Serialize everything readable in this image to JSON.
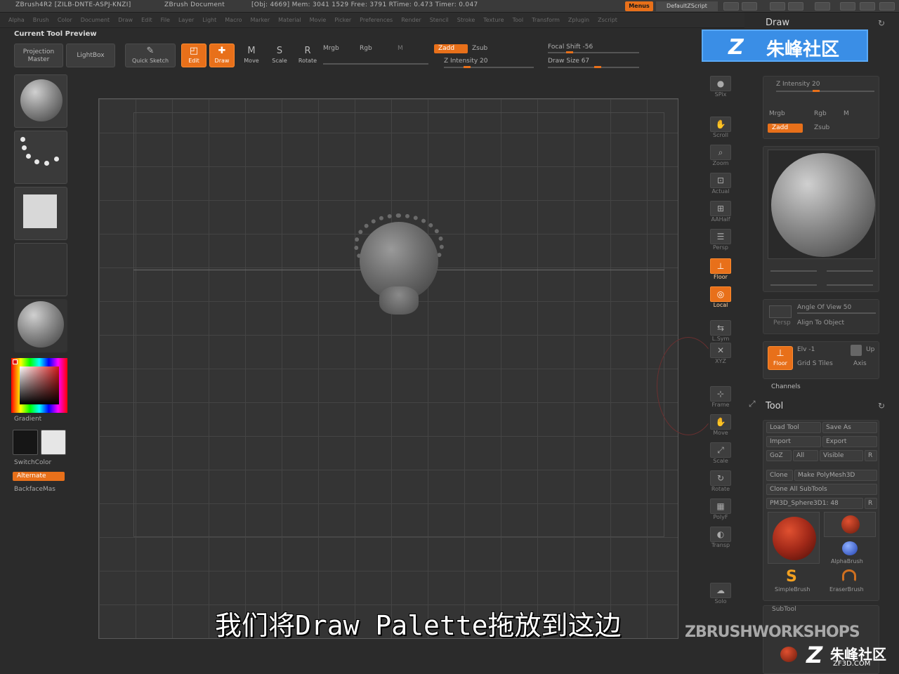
{
  "titlebar": {
    "app": "ZBrush4R2 [ZILB-DNTE-ASPJ-KNZI]",
    "document": "ZBrush Document",
    "stats": "[Obj: 4669] Mem: 3041 1529  Free: 3791  RTime: 0.473  Timer: 0.047",
    "menus": "Menus",
    "script": "DefaultZScript"
  },
  "menubar": [
    "Alpha",
    "Brush",
    "Color",
    "Document",
    "Draw",
    "Edit",
    "File",
    "Layer",
    "Light",
    "Macro",
    "Marker",
    "Material",
    "Movie",
    "Picker",
    "Preferences",
    "Render",
    "Stencil",
    "Stroke",
    "Texture",
    "Tool",
    "Transform",
    "Zplugin",
    "Zscript"
  ],
  "preview": {
    "title": "Current Tool Preview"
  },
  "toolbar": {
    "projection_master": "Projection Master",
    "lightbox": "LightBox",
    "quick_sketch": "Quick Sketch",
    "edit": "Edit",
    "draw": "Draw",
    "move": "Move",
    "scale": "Scale",
    "rotate": "Rotate",
    "mrgb": "Mrgb",
    "rgb": "Rgb",
    "m": "M",
    "zadd": "Zadd",
    "zsub": "Zsub",
    "z_intensity": "Z Intensity 20",
    "focal_shift": "Focal Shift -56",
    "draw_size": "Draw Size 67"
  },
  "left_shelf": {
    "gradient": "Gradient",
    "switch_color": "SwitchColor",
    "alternate": "Alternate",
    "backface": "BackfaceMas"
  },
  "right_shelf": [
    "SPix",
    "Scroll",
    "Zoom",
    "Actual",
    "AAHalf",
    "Persp",
    "Floor",
    "Local",
    "L.Sym",
    "XYZ",
    "Frame",
    "Move",
    "Scale",
    "Rotate",
    "PolyF",
    "Transp",
    "Solo"
  ],
  "draw_palette": {
    "title": "Draw",
    "z_intensity": "Z Intensity 20",
    "mrgb": "Mrgb",
    "rgb": "Rgb",
    "m": "M",
    "zadd": "Zadd",
    "zsub": "Zsub",
    "persp": "Persp",
    "angle_of_view": "Angle Of View 50",
    "align_to_object": "Align To Object",
    "floor": "Floor",
    "elv": "Elv -1",
    "up": "Up",
    "grid_tiles": "Grid S Tiles",
    "axis": "Axis",
    "channels": "Channels"
  },
  "tool_palette": {
    "title": "Tool",
    "load_tool": "Load Tool",
    "save_as": "Save As",
    "import": "Import",
    "export": "Export",
    "goz": "GoZ",
    "all": "All",
    "visible": "Visible",
    "r": "R",
    "clone": "Clone",
    "make_polymesh": "Make PolyMesh3D",
    "clone_all": "Clone All SubTools",
    "mesh_name": "PM3D_Sphere3D1: 48",
    "alpha_brush": "AlphaBrush",
    "simple_brush": "SimpleBrush",
    "eraser_brush": "EraserBrush",
    "subtool": "SubTool"
  },
  "subtitle": "我们将Draw Palette拖放到这边",
  "watermark": {
    "brand": "朱峰社区",
    "workshops": "ZBRUSHWORKSHOPS",
    "site": "ZF3D.COM"
  },
  "colors": {
    "accent": "#e8701a",
    "background": "#2b2b2b",
    "watermark_blue": "#3a8ee6"
  }
}
